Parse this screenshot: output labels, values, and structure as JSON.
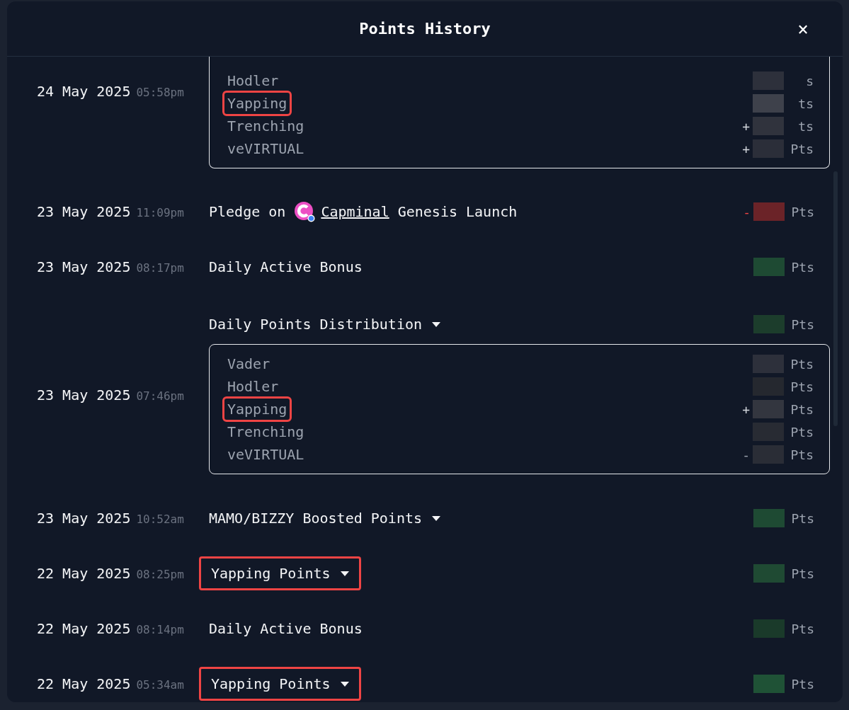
{
  "dialog": {
    "title": "Points History",
    "close": "×"
  },
  "rows": [
    {
      "kind": "group",
      "date": "24 May 2025",
      "time": "05:58pm",
      "cut_top": true,
      "expanded": true,
      "items": [
        {
          "label": "Hodler",
          "highlighted": false,
          "amount": {
            "unit": "s",
            "color": "#2d303b"
          }
        },
        {
          "label": "Yapping",
          "highlighted": true,
          "amount": {
            "unit": "ts",
            "color": "#3e414b"
          }
        },
        {
          "label": "Trenching",
          "highlighted": false,
          "amount": {
            "sign": {
              "text": "+",
              "color": "#d1d5db"
            },
            "unit": "ts",
            "color": "#30333d"
          }
        },
        {
          "label": "veVIRTUAL",
          "highlighted": false,
          "amount": {
            "sign": {
              "text": "+",
              "color": "#d1d5db"
            },
            "unit": "Pts",
            "color": "#2b2e39"
          }
        }
      ]
    },
    {
      "kind": "link",
      "date": "23 May 2025",
      "time": "11:09pm",
      "title_before": "Pledge on",
      "link": "Capminal",
      "title_after": "Genesis Launch",
      "highlighted": false,
      "amount": {
        "sign": {
          "text": "-",
          "color": "#ef4444"
        },
        "unit": "Pts",
        "color": "#6b2328"
      }
    },
    {
      "kind": "plain",
      "date": "23 May 2025",
      "time": "08:17pm",
      "title": "Daily Active Bonus",
      "highlighted": false,
      "amount": {
        "unit": "Pts",
        "color": "#1e4a33"
      }
    },
    {
      "kind": "group",
      "date": "23 May 2025",
      "time": "07:46pm",
      "title": "Daily Points Distribution",
      "expanded": true,
      "highlighted": false,
      "amount": {
        "unit": "Pts",
        "color": "#1c3d2c"
      },
      "items": [
        {
          "label": "Vader",
          "highlighted": false,
          "amount": {
            "unit": "Pts",
            "color": "#2d303b"
          }
        },
        {
          "label": "Hodler",
          "highlighted": false,
          "amount": {
            "unit": "Pts",
            "color": "#25282f"
          }
        },
        {
          "label": "Yapping",
          "highlighted": true,
          "amount": {
            "sign": {
              "text": "+",
              "color": "#d1d5db"
            },
            "unit": "Pts",
            "color": "#33363f"
          }
        },
        {
          "label": "Trenching",
          "highlighted": false,
          "amount": {
            "unit": "Pts",
            "color": "#282b33"
          }
        },
        {
          "label": "veVIRTUAL",
          "highlighted": false,
          "amount": {
            "sign": {
              "text": "-",
              "color": "#9ca3af"
            },
            "unit": "Pts",
            "color": "#2a2d36"
          }
        }
      ]
    },
    {
      "kind": "group",
      "date": "23 May 2025",
      "time": "10:52am",
      "title": "MAMO/BIZZY Boosted Points",
      "highlighted": false,
      "amount": {
        "unit": "Pts",
        "color": "#1e4a33"
      }
    },
    {
      "kind": "group",
      "date": "22 May 2025",
      "time": "08:25pm",
      "title": "Yapping Points",
      "highlighted": true,
      "amount": {
        "unit": "Pts",
        "color": "#1f4a33"
      }
    },
    {
      "kind": "plain",
      "date": "22 May 2025",
      "time": "08:14pm",
      "title": "Daily Active Bonus",
      "highlighted": false,
      "amount": {
        "unit": "Pts",
        "color": "#1a3a2a"
      }
    },
    {
      "kind": "group",
      "date": "22 May 2025",
      "time": "05:34am",
      "title": "Yapping Points",
      "highlighted": true,
      "amount": {
        "unit": "Pts",
        "color": "#1f5236"
      }
    }
  ]
}
